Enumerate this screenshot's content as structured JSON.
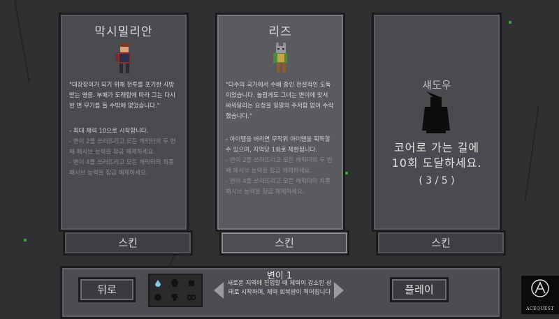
{
  "characters": [
    {
      "name": "막시밀리안",
      "quote": "\"대장장이가 되기 위해 전투를 포기한 사방받는 영웅. 부패가 도래함에 따라 그는 다시 한 번 무기를 들 수밖에 없었습니다.\"",
      "rule_main": "- 최대 체력 10으로 시작합니다.",
      "rule_sub1": "- 변이 2를 쓰러뜨리고 모든 캐릭터의 두 번째 패시브 능력을 잠금 해제하세요.",
      "rule_sub2": "- 변이 4를 쓰러뜨리고 모든 캐릭터의 최종 패시브 능력을 잠금 해제하세요.",
      "skin_label": "스킨"
    },
    {
      "name": "리즈",
      "quote": "\"다수의 국가에서 수배 중인 전설적인 도둑이었습니다. 놀랍게도 그녀는 변이에 맞서 싸워달라는 요청을 일말의 주저함 없이 수락했습니다.\"",
      "rule_main": "- 아이템을 버리면 무작위 아이템을 획득할 수 있으며, 지역당 1회로 제한됩니다.",
      "rule_sub1": "- 변이 2를 쓰러뜨리고 모든 캐릭터의 두 번째 패시브 능력을 잠금 해제하세요.",
      "rule_sub2": "- 변이 4를 쓰러뜨리고 모든 캐릭터의 최종 패시브 능력을 잠금 해제하세요.",
      "skin_label": "스킨"
    },
    {
      "name": "섀도우",
      "goal": "코어로 가는 길에 10회 도달하세요.",
      "progress": "( 3 / 5 )",
      "skin_label": "스킨"
    }
  ],
  "bottom": {
    "back_label": "뒤로",
    "play_label": "플레이",
    "difficulty_title": "변이 1",
    "difficulty_desc": "새로운 지역에 진입할 때 체력이 감소된 상태로 시작하며, 체력 회복량이 적어집니다"
  },
  "logo": {
    "text": "ACEQUEST"
  },
  "colors": {
    "background": "#2f3032",
    "card": "#4a4b4e",
    "card_selected": "#5a5b5e",
    "vine": "#3f9b3a"
  }
}
